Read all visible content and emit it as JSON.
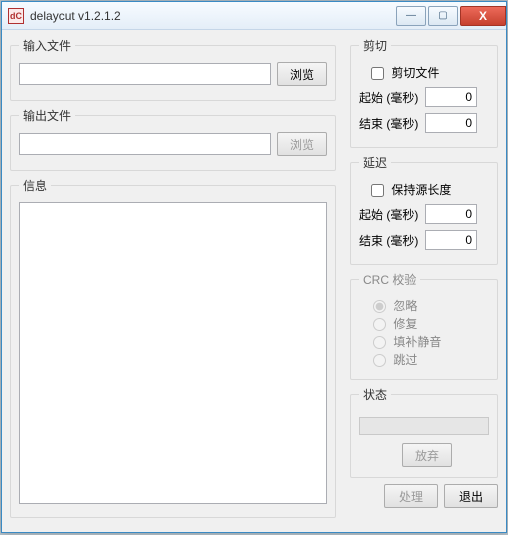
{
  "titlebar": {
    "icon_text": "dC",
    "title": "delaycut v1.2.1.2",
    "min": "—",
    "max": "▢",
    "close": "X"
  },
  "input_file": {
    "legend": "输入文件",
    "value": "",
    "browse": "浏览"
  },
  "output_file": {
    "legend": "输出文件",
    "value": "",
    "browse": "浏览"
  },
  "info": {
    "legend": "信息",
    "content": ""
  },
  "cut": {
    "legend": "剪切",
    "checkbox_label": "剪切文件",
    "start_label": "起始 (毫秒)",
    "start_value": "0",
    "end_label": "结束 (毫秒)",
    "end_value": "0"
  },
  "delay": {
    "legend": "延迟",
    "checkbox_label": "保持源长度",
    "start_label": "起始 (毫秒)",
    "start_value": "0",
    "end_label": "结束 (毫秒)",
    "end_value": "0"
  },
  "crc": {
    "legend": "CRC 校验",
    "options": {
      "ignore": "忽略",
      "fix": "修复",
      "silence": "填补静音",
      "skip": "跳过"
    }
  },
  "status": {
    "legend": "状态",
    "abort": "放弃"
  },
  "buttons": {
    "process": "处理",
    "quit": "退出"
  }
}
